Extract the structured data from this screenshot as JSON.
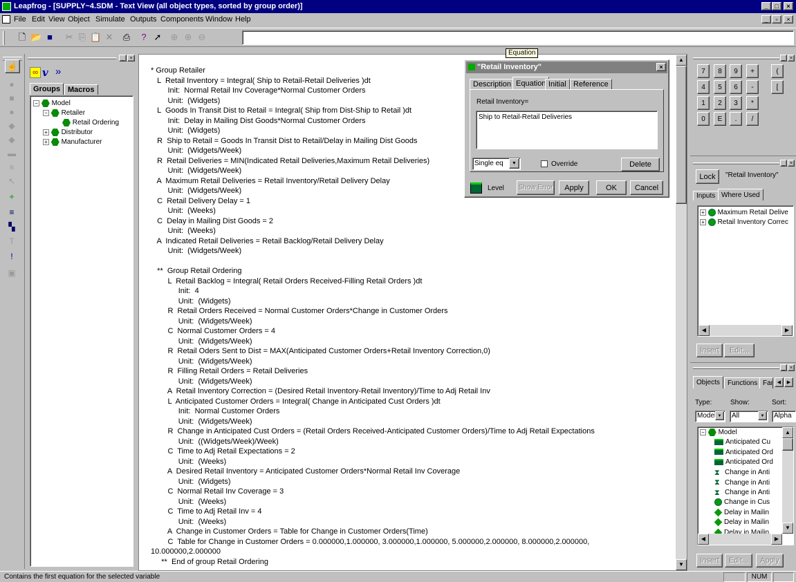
{
  "window": {
    "title": "Leapfrog - [SUPPLY~4.SDM - Text View (all object types, sorted by group order)]"
  },
  "menu": [
    "File",
    "Edit",
    "View",
    "Object",
    "Simulate",
    "Outputs",
    "Components",
    "Window",
    "Help"
  ],
  "tooltip": "Equation",
  "left_panel": {
    "tabs": [
      "Groups",
      "Macros"
    ],
    "tree": [
      {
        "label": "Model",
        "level": 0
      },
      {
        "label": "Retailer",
        "level": 1
      },
      {
        "label": "Retail Ordering",
        "level": 2
      },
      {
        "label": "Distributor",
        "level": 1
      },
      {
        "label": "Manufacturer",
        "level": 1
      }
    ]
  },
  "equations": [
    "* Group Retailer",
    "   L  Retail Inventory = Integral( Ship to Retail-Retail Deliveries )dt",
    "        Init:  Normal Retail Inv Coverage*Normal Customer Orders",
    "        Unit:  (Widgets)",
    "   L  Goods In Transit Dist to Retail = Integral( Ship from Dist-Ship to Retail )dt",
    "        Init:  Delay in Mailing Dist Goods*Normal Customer Orders",
    "        Unit:  (Widgets)",
    "   R  Ship to Retail = Goods In Transit Dist to Retail/Delay in Mailing Dist Goods",
    "        Unit:  (Widgets/Week)",
    "   R  Retail Deliveries = MIN(Indicated Retail Deliveries,Maximum Retail Deliveries)",
    "        Unit:  (Widgets/Week)",
    "   A  Maximum Retail Deliveries = Retail Inventory/Retail Delivery Delay",
    "        Unit:  (Widgets/Week)",
    "   C  Retail Delivery Delay = 1",
    "        Unit:  (Weeks)",
    "   C  Delay in Mailing Dist Goods = 2",
    "        Unit:  (Weeks)",
    "   A  Indicated Retail Deliveries = Retail Backlog/Retail Delivery Delay",
    "        Unit:  (Widgets/Week)",
    "",
    "   **  Group Retail Ordering",
    "        L  Retail Backlog = Integral( Retail Orders Received-Filling Retail Orders )dt",
    "             Init:  4",
    "             Unit:  (Widgets)",
    "        R  Retail Orders Received = Normal Customer Orders*Change in Customer Orders",
    "             Unit:  (Widgets/Week)",
    "        C  Normal Customer Orders = 4",
    "             Unit:  (Widgets/Week)",
    "        R  Retail Oders Sent to Dist = MAX(Anticipated Customer Orders+Retail Inventory Correction,0)",
    "             Unit:  (Widgets/Week)",
    "        R  Filling Retail Orders = Retail Deliveries",
    "             Unit:  (Widgets/Week)",
    "        A  Retail Inventory Correction = (Desired Retail Inventory-Retail Inventory)/Time to Adj Retail Inv",
    "        L  Anticipated Customer Orders = Integral( Change in Anticipated Cust Orders )dt",
    "             Init:  Normal Customer Orders",
    "             Unit:  (Widgets/Week)",
    "        R  Change in Anticipated Cust Orders = (Retail Orders Received-Anticipated Customer Orders)/Time to Adj Retail Expectations",
    "             Unit:  ((Widgets/Week)/Week)",
    "        C  Time to Adj Retail Expectations = 2",
    "             Unit:  (Weeks)",
    "        A  Desired Retail Inventory = Anticipated Customer Orders*Normal Retail Inv Coverage",
    "             Unit:  (Widgets)",
    "        C  Normal Retail Inv Coverage = 3",
    "             Unit:  (Weeks)",
    "        C  Time to Adj Retail Inv = 4",
    "             Unit:  (Weeks)",
    "        A  Change in Customer Orders = Table for Change in Customer Orders(Time)",
    "        C  Table for Change in Customer Orders = 0.000000,1.000000, 3.000000,1.000000, 5.000000,2.000000, 8.000000,2.000000,",
    "10.000000,2.000000",
    "     **  End of group Retail Ordering"
  ],
  "dialog": {
    "title": "\"Retail Inventory\"",
    "tabs": [
      "Description",
      "Equation",
      "Initial",
      "Reference"
    ],
    "label": "Retail Inventory=",
    "value": "Ship to Retail-Retail Deliveries",
    "select": "Single eq",
    "override": "Override",
    "delete": "Delete",
    "level": "Level",
    "show_error": "Show Error",
    "apply": "Apply",
    "ok": "OK",
    "cancel": "Cancel"
  },
  "calculator": {
    "rows": [
      [
        "7",
        "8",
        "9",
        "+",
        "("
      ],
      [
        "4",
        "5",
        "6",
        "-",
        "["
      ],
      [
        "1",
        "2",
        "3",
        "*"
      ],
      [
        "0",
        "E",
        ".",
        "/"
      ]
    ]
  },
  "where_used": {
    "lock": "Lock",
    "title": "\"Retail Inventory\"",
    "tabs": [
      "Inputs",
      "Where Used"
    ],
    "items": [
      "Maximum Retail Delive",
      "Retail Inventory Correc"
    ],
    "insert": "Insert",
    "edit": "Edit..."
  },
  "objects": {
    "tabs": [
      "Objects",
      "Functions",
      "Fam"
    ],
    "type_label": "Type:",
    "show_label": "Show:",
    "sort_label": "Sort:",
    "type_val": "Model",
    "show_val": "All",
    "sort_val": "Alpha",
    "root": "Model",
    "items": [
      {
        "label": "Anticipated Cu",
        "icon": "rect"
      },
      {
        "label": "Anticipated Ord",
        "icon": "rect"
      },
      {
        "label": "Anticipated Ord",
        "icon": "rect"
      },
      {
        "label": "Change in Anti",
        "icon": "valve"
      },
      {
        "label": "Change in Anti",
        "icon": "valve"
      },
      {
        "label": "Change in Anti",
        "icon": "valve"
      },
      {
        "label": "Change in Cus",
        "icon": "circle"
      },
      {
        "label": "Delay in Mailin",
        "icon": "diamond"
      },
      {
        "label": "Delay in Mailin",
        "icon": "diamond"
      },
      {
        "label": "Delay in Mailin",
        "icon": "diamond"
      }
    ],
    "insert": "Insert",
    "edit": "Edit...",
    "apply": "Apply"
  },
  "status": {
    "text": "Contains the first equation for the selected variable",
    "num": "NUM"
  }
}
